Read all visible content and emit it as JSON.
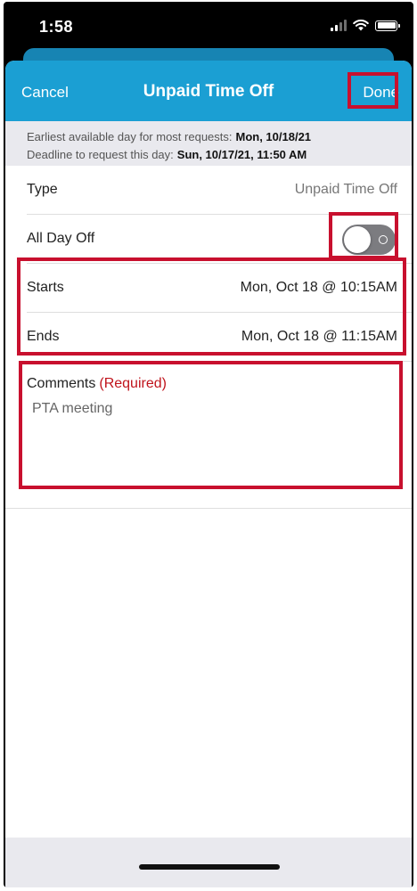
{
  "status_bar": {
    "time": "1:58",
    "icons": [
      "cellular-signal-icon",
      "wifi-icon",
      "battery-icon"
    ]
  },
  "nav": {
    "cancel_label": "Cancel",
    "title": "Unpaid Time Off",
    "done_label": "Done",
    "bar_color": "#1b9fd3"
  },
  "info": {
    "earliest_label": "Earliest available day for most requests:",
    "earliest_value": "Mon, 10/18/21",
    "deadline_label": "Deadline to request this day:",
    "deadline_value": "Sun, 10/17/21, 11:50 AM"
  },
  "form": {
    "type": {
      "label": "Type",
      "value": "Unpaid Time Off"
    },
    "all_day": {
      "label": "All Day Off",
      "on": false
    },
    "starts": {
      "label": "Starts",
      "value": "Mon, Oct 18 @ 10:15AM"
    },
    "ends": {
      "label": "Ends",
      "value": "Mon, Oct 18 @ 11:15AM"
    },
    "comments": {
      "label": "Comments",
      "required": "(Required)",
      "value": "PTA meeting"
    }
  },
  "highlight_color": "#c8102e"
}
